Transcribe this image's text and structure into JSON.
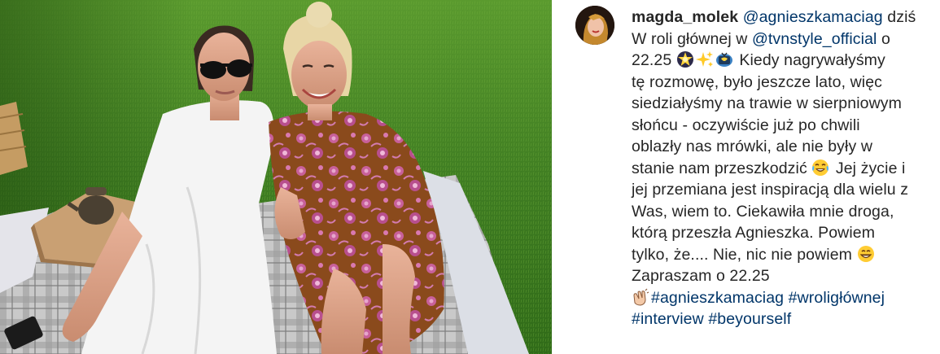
{
  "post": {
    "username": "magda_molek",
    "caption_lines": [
      [
        {
          "t": "mention",
          "v": "@agnieszkamaciag"
        },
        {
          "t": "text",
          "v": " dziś"
        }
      ],
      [
        {
          "t": "text",
          "v": "W roli głównej w "
        },
        {
          "t": "mention",
          "v": "@tvnstyle_official"
        },
        {
          "t": "text",
          "v": " o"
        }
      ],
      [
        {
          "t": "text",
          "v": "22.25 "
        },
        {
          "t": "emoji",
          "v": "star-icon"
        },
        {
          "t": "emoji",
          "v": "sparkles-icon"
        },
        {
          "t": "emoji",
          "v": "tv-icon"
        },
        {
          "t": "text",
          "v": " Kiedy nagrywałyśmy"
        }
      ],
      [
        {
          "t": "text",
          "v": "tę rozmowę, było jeszcze lato, więc"
        }
      ],
      [
        {
          "t": "text",
          "v": "siedziałyśmy na trawie w sierpniowym"
        }
      ],
      [
        {
          "t": "text",
          "v": "słońcu - oczywiście już po chwili"
        }
      ],
      [
        {
          "t": "text",
          "v": "oblazły nas mrówki, ale nie były w"
        }
      ],
      [
        {
          "t": "text",
          "v": "stanie nam przeszkodzić "
        },
        {
          "t": "emoji",
          "v": "tears-of-joy-icon"
        },
        {
          "t": "text",
          "v": " Jej życie i"
        }
      ],
      [
        {
          "t": "text",
          "v": "jej przemiana jest inspiracją dla wielu z"
        }
      ],
      [
        {
          "t": "text",
          "v": "Was, wiem to. Ciekawiła mnie droga,"
        }
      ],
      [
        {
          "t": "text",
          "v": "którą przeszła Agnieszka. Powiem"
        }
      ],
      [
        {
          "t": "text",
          "v": "tylko, że.... Nie, nic nie powiem "
        },
        {
          "t": "emoji",
          "v": "grin-icon"
        }
      ],
      [
        {
          "t": "text",
          "v": "Zapraszam o 22.25"
        }
      ],
      [
        {
          "t": "emoji",
          "v": "clap-icon"
        },
        {
          "t": "tag",
          "v": "#agnieszkamaciag"
        },
        {
          "t": "text",
          "v": " "
        },
        {
          "t": "tag",
          "v": "#wroligłównej"
        }
      ],
      [
        {
          "t": "tag",
          "v": "#interview"
        },
        {
          "t": "text",
          "v": " "
        },
        {
          "t": "tag",
          "v": "#beyourself"
        }
      ]
    ]
  },
  "colors": {
    "text": "#262626",
    "link": "#003569",
    "grass": "#3f7a20"
  }
}
